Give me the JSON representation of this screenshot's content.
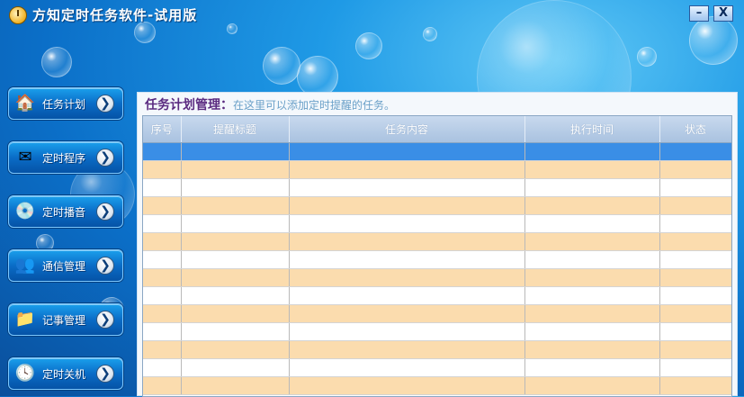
{
  "window": {
    "title": "方知定时任务软件-试用版",
    "minimize_label": "–",
    "close_label": "X"
  },
  "sidebar": {
    "items": [
      {
        "label": "任务计划",
        "icon": "house-icon"
      },
      {
        "label": "定时程序",
        "icon": "envelope-icon"
      },
      {
        "label": "定时播音",
        "icon": "cd-disc-icon"
      },
      {
        "label": "通信管理",
        "icon": "contacts-icon"
      },
      {
        "label": "记事管理",
        "icon": "folder-icon"
      },
      {
        "label": "定时关机",
        "icon": "clock-icon"
      }
    ],
    "arrow_glyph": "❯"
  },
  "main": {
    "title": "任务计划管理：",
    "description": "在这里可以添加定时提醒的任务。",
    "table": {
      "columns": [
        "序号",
        "提醒标题",
        "任务内容",
        "执行时间",
        "状态"
      ],
      "row_count": 14,
      "selected_row": 0
    }
  },
  "colors": {
    "selected_row": "#3a8ee6",
    "alt_row": "#fbdcae",
    "title_accent": "#5a2a80"
  }
}
